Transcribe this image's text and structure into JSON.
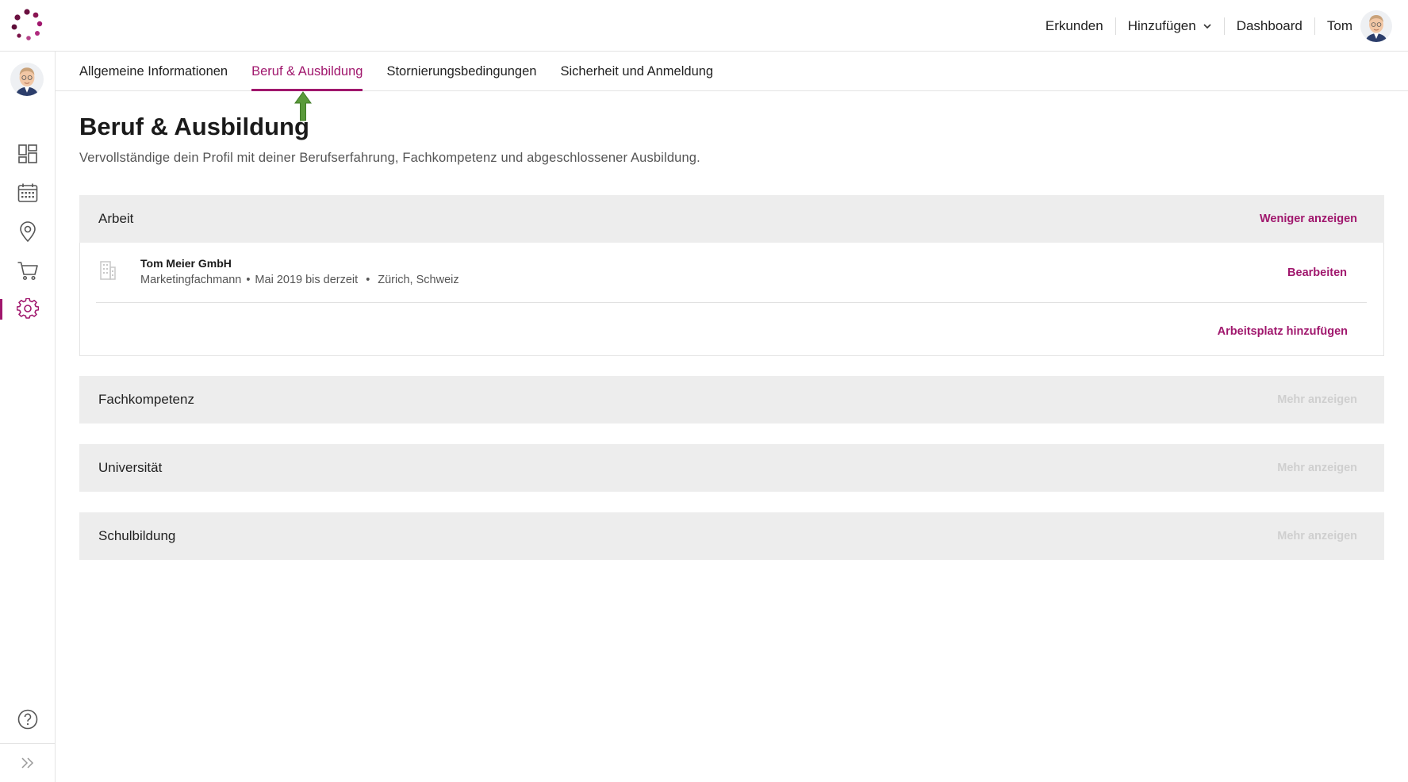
{
  "header": {
    "nav": [
      {
        "label": "Erkunden"
      },
      {
        "label": "Hinzufügen"
      },
      {
        "label": "Dashboard"
      }
    ],
    "user_name": "Tom"
  },
  "tabs": [
    {
      "label": "Allgemeine Informationen",
      "active": false
    },
    {
      "label": "Beruf & Ausbildung",
      "active": true
    },
    {
      "label": "Stornierungsbedingungen",
      "active": false
    },
    {
      "label": "Sicherheit und Anmeldung",
      "active": false
    }
  ],
  "sidebar": {
    "items": [
      {
        "icon": "dashboard-icon"
      },
      {
        "icon": "calendar-icon"
      },
      {
        "icon": "location-pin-icon"
      },
      {
        "icon": "cart-icon"
      },
      {
        "icon": "gear-icon",
        "active": true
      }
    ],
    "bottom": [
      {
        "icon": "help-icon"
      },
      {
        "icon": "expand-icon"
      }
    ]
  },
  "page": {
    "title": "Beruf & Ausbildung",
    "subtitle": "Vervollständige dein Profil mit deiner Berufserfahrung, Fachkompetenz und abgeschlossener Ausbildung."
  },
  "work": {
    "title": "Arbeit",
    "toggle_label": "Weniger anzeigen",
    "entries": [
      {
        "company": "Tom Meier GmbH",
        "position": "Marketingfachmann",
        "period": "Mai 2019 bis derzeit",
        "location": "Zürich, Schweiz",
        "edit_label": "Bearbeiten"
      }
    ],
    "add_label": "Arbeitsplatz hinzufügen"
  },
  "sections": [
    {
      "title": "Fachkompetenz",
      "toggle_label": "Mehr anzeigen"
    },
    {
      "title": "Universität",
      "toggle_label": "Mehr anzeigen"
    },
    {
      "title": "Schulbildung",
      "toggle_label": "Mehr anzeigen"
    }
  ],
  "colors": {
    "accent": "#a0176d",
    "section_bg": "#ededed",
    "muted_link": "#cfcfcf"
  }
}
